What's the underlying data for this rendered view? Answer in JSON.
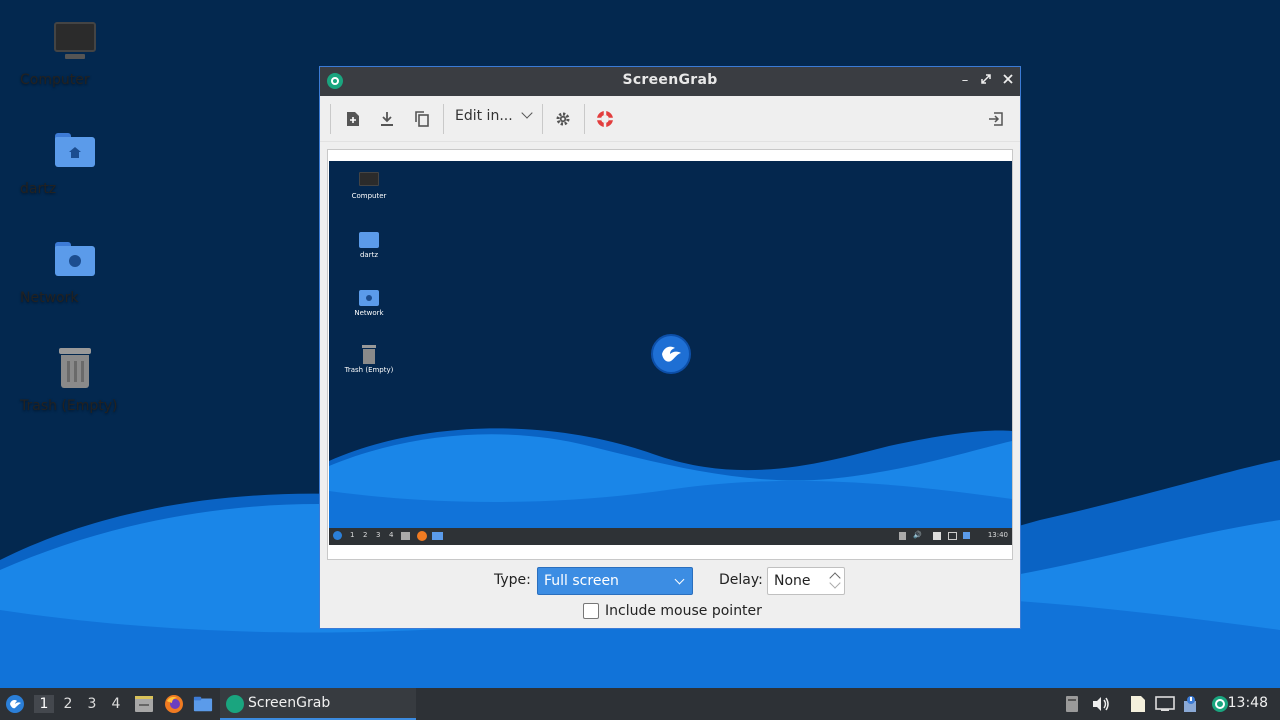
{
  "desktop": {
    "icons": [
      {
        "label": "Computer"
      },
      {
        "label": "dartz"
      },
      {
        "label": "Network"
      },
      {
        "label": "Trash (Empty)"
      }
    ]
  },
  "window": {
    "title": "ScreenGrab",
    "toolbar": {
      "new_icon": "new-screenshot-icon",
      "save_icon": "save-icon",
      "copy_icon": "copy-icon",
      "edit_label": "Edit in...",
      "settings_icon": "gear-icon",
      "help_icon": "lifebuoy-icon",
      "quit_icon": "exit-icon"
    },
    "preview": {
      "icons": [
        "Computer",
        "dartz",
        "Network",
        "Trash (Empty)"
      ],
      "taskbar_workspaces": [
        "1",
        "2",
        "3",
        "4"
      ],
      "clock": "13:40"
    },
    "controls": {
      "type_label": "Type:",
      "type_value": "Full screen",
      "delay_label": "Delay:",
      "delay_value": "None",
      "mouse_pointer_label": "Include mouse pointer",
      "mouse_pointer_checked": false
    }
  },
  "taskbar": {
    "workspaces": [
      "1",
      "2",
      "3",
      "4"
    ],
    "active_workspace": "1",
    "task_label": "ScreenGrab",
    "clock": "13:48"
  },
  "colors": {
    "accent": "#3c8de3",
    "panel": "#2d3136",
    "desktop": "#042a55"
  }
}
